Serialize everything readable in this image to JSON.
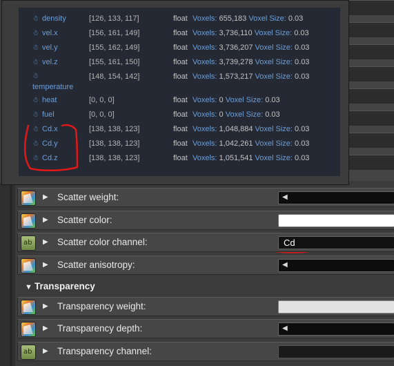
{
  "grids": [
    {
      "name": "density",
      "range": "[126, 133, 117]",
      "type": "float",
      "voxels_label": "Voxels:",
      "voxels": "655,183",
      "size_label": "Voxel Size:",
      "size": "0.03"
    },
    {
      "name": "vel.x",
      "range": "[156, 161, 149]",
      "type": "float",
      "voxels_label": "Voxels:",
      "voxels": "3,736,110",
      "size_label": "Voxel Size:",
      "size": "0.03"
    },
    {
      "name": "vel.y",
      "range": "[155, 162, 149]",
      "type": "float",
      "voxels_label": "Voxels:",
      "voxels": "3,736,207",
      "size_label": "Voxel Size:",
      "size": "0.03"
    },
    {
      "name": "vel.z",
      "range": "[155, 161, 150]",
      "type": "float",
      "voxels_label": "Voxels:",
      "voxels": "3,739,278",
      "size_label": "Voxel Size:",
      "size": "0.03"
    },
    {
      "name": "temperature",
      "range": "[148, 154, 142]",
      "type": "float",
      "voxels_label": "Voxels:",
      "voxels": "1,573,217",
      "size_label": "Voxel Size:",
      "size": "0.03"
    },
    {
      "name": "heat",
      "range": "[0, 0, 0]",
      "type": "float",
      "voxels_label": "Voxels:",
      "voxels": "0",
      "size_label": "Voxel Size:",
      "size": "0.03"
    },
    {
      "name": "fuel",
      "range": "[0, 0, 0]",
      "type": "float",
      "voxels_label": "Voxels:",
      "voxels": "0",
      "size_label": "Voxel Size:",
      "size": "0.03"
    },
    {
      "name": "Cd.x",
      "range": "[138, 138, 123]",
      "type": "float",
      "voxels_label": "Voxels:",
      "voxels": "1,048,884",
      "size_label": "Voxel Size:",
      "size": "0.03"
    },
    {
      "name": "Cd.y",
      "range": "[138, 138, 123]",
      "type": "float",
      "voxels_label": "Voxels:",
      "voxels": "1,042,261",
      "size_label": "Voxel Size:",
      "size": "0.03"
    },
    {
      "name": "Cd.z",
      "range": "[138, 138, 123]",
      "type": "float",
      "voxels_label": "Voxels:",
      "voxels": "1,051,541",
      "size_label": "Voxel Size:",
      "size": "0.03"
    }
  ],
  "params": {
    "scatter_weight": "Scatter weight:",
    "scatter_color": "Scatter color:",
    "scatter_color_channel": "Scatter color channel:",
    "scatter_color_channel_value": "Cd",
    "scatter_anisotropy": "Scatter anisotropy:",
    "transparency_section": "Transparency",
    "transparency_weight": "Transparency weight:",
    "transparency_depth": "Transparency depth:",
    "transparency_channel": "Transparency channel:"
  },
  "icons": {
    "grid": "volume-grid-icon",
    "expand": "expand-triangle-icon",
    "section_toggle": "collapse-triangle-icon",
    "pin_texture": "texture-connect-icon",
    "pin_string": "string-connect-icon",
    "slider_arrow": "slider-left-arrow-icon"
  },
  "colors": {
    "grid_name": "#6e9fd8",
    "annotation": "#e01818",
    "tooltip_bg": "#242933"
  },
  "string_pin_label": "ab"
}
